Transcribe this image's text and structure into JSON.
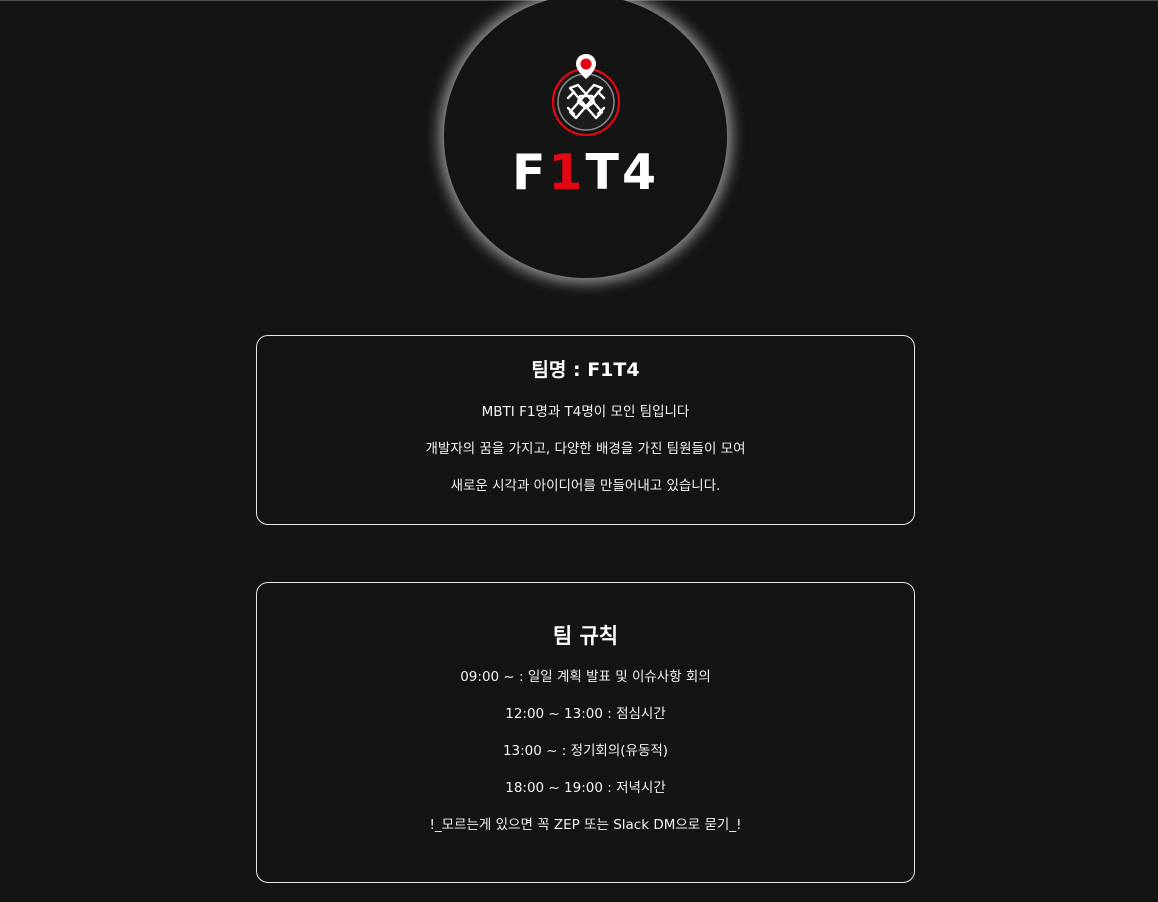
{
  "logo": {
    "wordmark_parts": [
      "F",
      "1",
      "T4"
    ],
    "emblem_icon": "hands-together-pin-icon",
    "colors": {
      "accent": "#e30613",
      "text": "#ffffff",
      "background": "#141414"
    }
  },
  "intro": {
    "title": "팀명 : F1T4",
    "lines": [
      "MBTI F1명과 T4명이 모인 팀입니다",
      "개발자의 꿈을 가지고, 다양한 배경을 가진 팀원들이 모여",
      "새로운 시각과 아이디어를 만들어내고 있습니다."
    ]
  },
  "rules": {
    "title": "팀 규칙",
    "lines": [
      "09:00 ~ : 일일 계획 발표 및 이슈사항 회의",
      "12:00 ~ 13:00 : 점심시간",
      "13:00 ~ : 정기회의(유동적)",
      "18:00 ~ 19:00 : 저녁시간",
      "!_모르는게 있으면 꼭 ZEP 또는 Slack DM으로 묻기_!"
    ]
  }
}
